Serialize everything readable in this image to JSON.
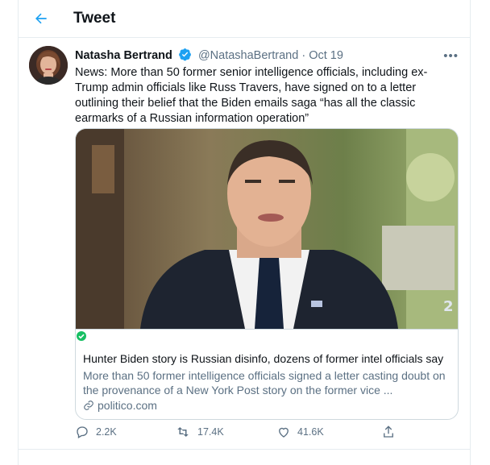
{
  "header": {
    "title": "Tweet"
  },
  "tweet": {
    "author_name": "Natasha Bertrand",
    "handle": "@NatashaBertrand",
    "separator": "·",
    "date": "Oct 19",
    "more": "•••",
    "text": "News: More than 50 former senior intelligence officials, including ex-Trump admin officials like Russ Travers, have signed on to a letter outlining their belief that the Biden emails saga “has all the classic earmarks of a Russian information operation”",
    "card": {
      "title": "Hunter Biden story is Russian disinfo, dozens of former intel officials say",
      "description": "More than 50 former intelligence officials signed a letter casting doubt on the provenance of a New York Post story on the former vice ...",
      "domain": "politico.com"
    },
    "actions": {
      "replies": "2.2K",
      "retweets": "17.4K",
      "likes": "41.6K"
    }
  },
  "colors": {
    "accent": "#1da1f2",
    "secondary_text": "#5b7083",
    "border": "#e6ecf0",
    "verified": "#1da1f2",
    "check_green": "#17bf63"
  }
}
